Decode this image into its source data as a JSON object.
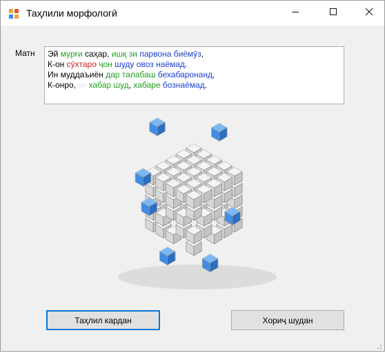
{
  "window": {
    "title": "Таҳлили морфологӣ",
    "app_icon": "app-grid-icon",
    "controls": {
      "minimize_icon": "minimize-icon",
      "maximize_icon": "maximize-icon",
      "close_icon": "close-icon"
    }
  },
  "form": {
    "text_label": "Матн",
    "text_lines": [
      [
        {
          "text": "Эй ",
          "color": "#000000"
        },
        {
          "text": "мурғи",
          "color": "#22a022"
        },
        {
          "text": " саҳар, ",
          "color": "#000000"
        },
        {
          "text": "ишқ",
          "color": "#22a022"
        },
        {
          "text": " ",
          "color": "#000000"
        },
        {
          "text": "зи",
          "color": "#22a022"
        },
        {
          "text": " ",
          "color": "#000000"
        },
        {
          "text": "парвона",
          "color": "#1c3fd4"
        },
        {
          "text": " ",
          "color": "#000000"
        },
        {
          "text": "биёмӯз",
          "color": "#1c3fd4"
        },
        {
          "text": ",",
          "color": "#000000"
        }
      ],
      [
        {
          "text": "К-он ",
          "color": "#000000"
        },
        {
          "text": "сӯхтаро",
          "color": "#d42020"
        },
        {
          "text": " ",
          "color": "#000000"
        },
        {
          "text": "ҷон",
          "color": "#22a022"
        },
        {
          "text": " ",
          "color": "#000000"
        },
        {
          "text": "шуду",
          "color": "#1c3fd4"
        },
        {
          "text": " ",
          "color": "#000000"
        },
        {
          "text": "овоз",
          "color": "#1c3fd4"
        },
        {
          "text": " ",
          "color": "#000000"
        },
        {
          "text": "наёмад",
          "color": "#1c3fd4"
        },
        {
          "text": ".",
          "color": "#000000"
        }
      ],
      [
        {
          "text": "Ин муддаъиён ",
          "color": "#000000"
        },
        {
          "text": "дар",
          "color": "#22a022"
        },
        {
          "text": " ",
          "color": "#000000"
        },
        {
          "text": "талабаш",
          "color": "#22a022"
        },
        {
          "text": " ",
          "color": "#000000"
        },
        {
          "text": "бехабаронанд",
          "color": "#1c3fd4"
        },
        {
          "text": ",",
          "color": "#000000"
        }
      ],
      [
        {
          "text": "К-онро, ",
          "color": "#000000"
        },
        {
          "text": "ки",
          "color": "#e8e8f4"
        },
        {
          "text": " ",
          "color": "#000000"
        },
        {
          "text": "хабар",
          "color": "#22a022"
        },
        {
          "text": " ",
          "color": "#000000"
        },
        {
          "text": "шуд",
          "color": "#22a022"
        },
        {
          "text": ", ",
          "color": "#000000"
        },
        {
          "text": "хабаре",
          "color": "#22a022"
        },
        {
          "text": " ",
          "color": "#000000"
        },
        {
          "text": "бознаёмад",
          "color": "#1c3fd4"
        },
        {
          "text": ".",
          "color": "#000000"
        }
      ]
    ],
    "illustration": "cube-grid-icon",
    "analyze_button": "Таҳлил кардан",
    "exit_button": "Хориҷ шудан"
  },
  "colors": {
    "accent": "#0078d7",
    "cube_blue": "#3d8ee6",
    "window_bg": "#f0f0f0"
  }
}
